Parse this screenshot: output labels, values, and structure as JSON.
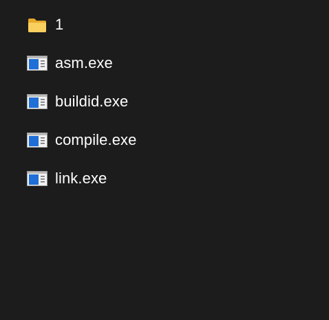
{
  "explorer": {
    "items": [
      {
        "label": "1",
        "type": "folder",
        "icon": "folder-icon"
      },
      {
        "label": "asm.exe",
        "type": "exe",
        "icon": "exe-app-icon"
      },
      {
        "label": "buildid.exe",
        "type": "exe",
        "icon": "exe-app-icon"
      },
      {
        "label": "compile.exe",
        "type": "exe",
        "icon": "exe-app-icon"
      },
      {
        "label": "link.exe",
        "type": "exe",
        "icon": "exe-app-icon"
      }
    ]
  },
  "colors": {
    "background": "#1c1c1c",
    "text": "#ffffff",
    "folder": "#f4c54a",
    "exe_accent": "#1f6fd6"
  }
}
